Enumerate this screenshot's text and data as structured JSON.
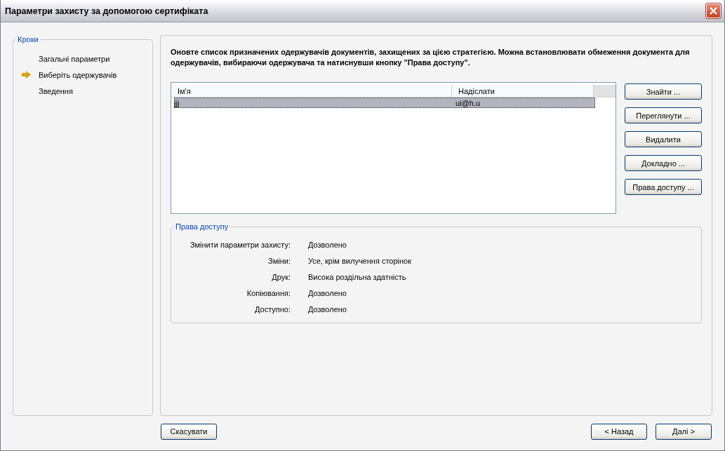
{
  "window": {
    "title": "Параметри захисту за допомогою сертифіката"
  },
  "steps": {
    "title": "Кроки",
    "items": [
      {
        "label": "Загальні параметри",
        "selected": false
      },
      {
        "label": "Виберіть одержувачів",
        "selected": true
      },
      {
        "label": "Зведення",
        "selected": false
      }
    ]
  },
  "instructions": "Оновте список призначених одержувачів документів, захищених за цією стратегією. Можна встановлювати обмеження документа для одержувачів, вибираючи одержувача та натиснувши кнопку \"Права доступу\".",
  "table": {
    "columns": [
      "Ім'я",
      "Надіслати"
    ],
    "rows": [
      {
        "cells": [
          "jjj",
          "ui@h.u"
        ],
        "selected": true
      }
    ]
  },
  "side_buttons": [
    "Знайти ...",
    "Переглянути ...",
    "Видалити",
    "Докладно ...",
    "Права доступу ..."
  ],
  "permissions": {
    "title": "Права доступу",
    "rows": [
      {
        "label": "Змінити параметри захисту:",
        "value": "Дозволено"
      },
      {
        "label": "Зміни:",
        "value": "Усе, крім вилучення сторінок"
      },
      {
        "label": "Друк:",
        "value": "Висока роздільна здатність"
      },
      {
        "label": "Копіювання:",
        "value": "Дозволено"
      },
      {
        "label": "Доступно:",
        "value": "Дозволено"
      }
    ]
  },
  "footer": {
    "cancel": "Скасувати",
    "back": "< Назад",
    "next": "Далі >"
  }
}
